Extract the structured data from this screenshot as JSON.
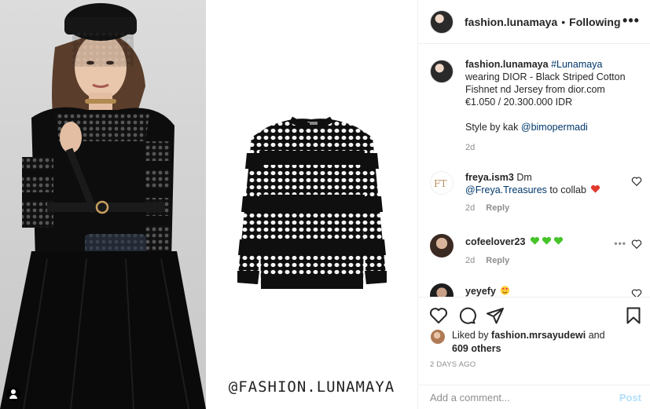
{
  "media": {
    "watermark": "@FASHION.LUNAMAYA"
  },
  "header": {
    "username": "fashion.lunamaya",
    "separator": "•",
    "follow_state": "Following",
    "more_icon": "more-horizontal-icon"
  },
  "caption": {
    "username": "fashion.lunamaya",
    "hashtag": "#Lunamaya",
    "line1": "wearing DIOR - Black Striped Cotton Fishnet nd Jersey from dior.com",
    "price": "€1.050 / 20.300.000 IDR",
    "style_prefix": "Style by kak",
    "style_mention": "@bimopermadi",
    "time": "2d"
  },
  "comments": [
    {
      "username": "freya.ism3",
      "text_before": "Dm",
      "mention": "@Freya.Treasures",
      "text_after": "to collab",
      "emoji": "heart-icon",
      "time": "2d",
      "reply": "Reply"
    },
    {
      "username": "cofeelover23",
      "emoji": "green-heart-icon x3",
      "time": "2d",
      "reply": "Reply"
    },
    {
      "username": "yeyefy",
      "emoji": "heart-eyes-icon"
    }
  ],
  "actions": {
    "like_icon": "heart-icon",
    "comment_icon": "comment-icon",
    "share_icon": "share-icon",
    "save_icon": "bookmark-icon"
  },
  "likes": {
    "prefix": "Liked by",
    "user": "fashion.mrsayudewi",
    "and": "and",
    "others": "609 others"
  },
  "post_time": "2 DAYS AGO",
  "add_comment": {
    "placeholder": "Add a comment...",
    "post_label": "Post"
  },
  "colors": {
    "link": "#00376b",
    "muted": "#8e8e8e",
    "post_disabled": "#b2dffc",
    "divider": "#efefef"
  }
}
